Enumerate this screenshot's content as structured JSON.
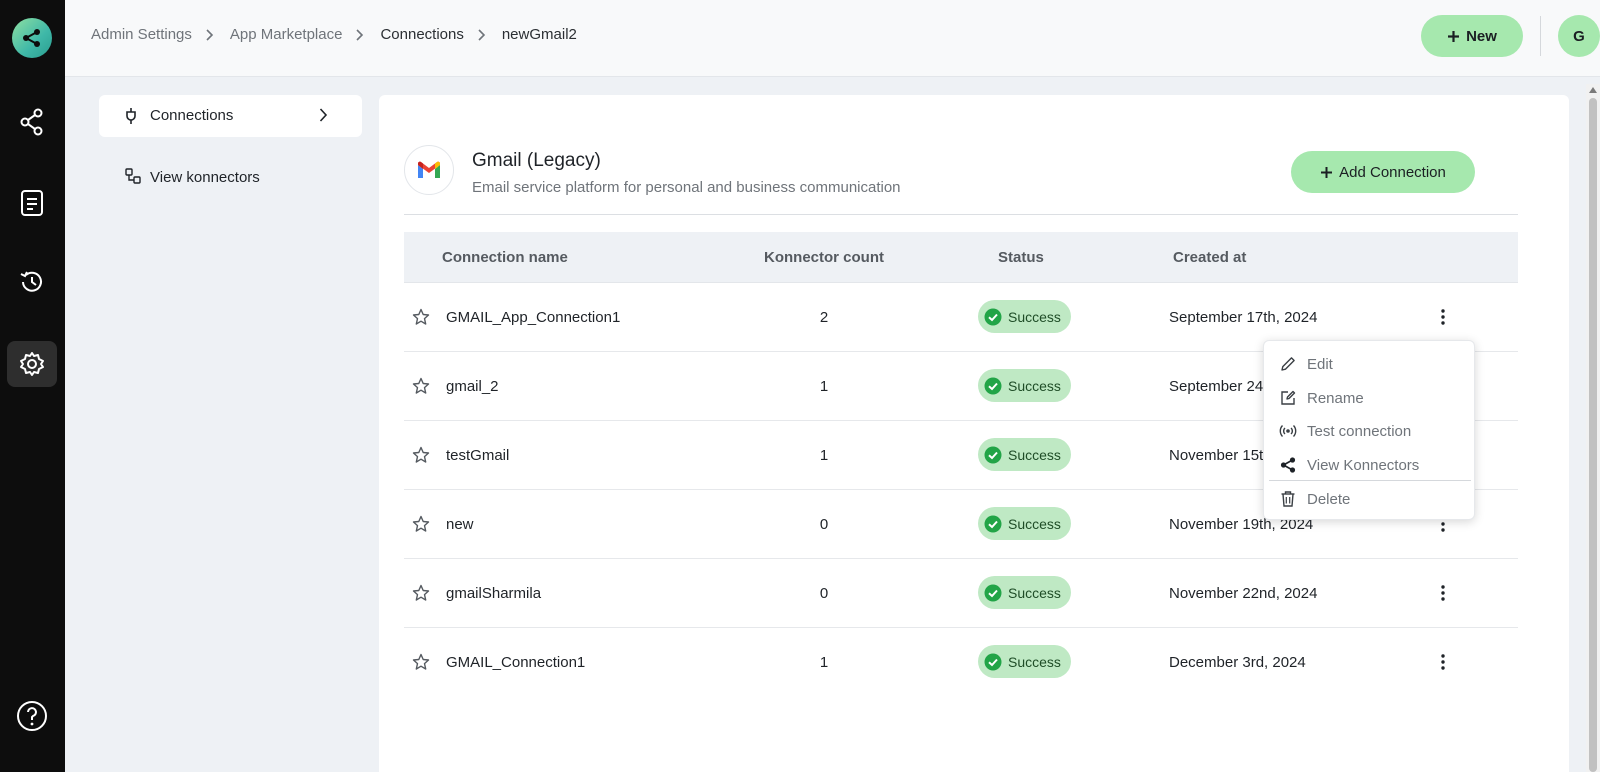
{
  "breadcrumb": [
    "Admin Settings",
    "App Marketplace",
    "Connections",
    "newGmail2"
  ],
  "header": {
    "new_label": "New",
    "avatar_initial": "G"
  },
  "subnav": {
    "connections_label": "Connections",
    "view_konnectors_label": "View konnectors"
  },
  "app": {
    "title": "Gmail (Legacy)",
    "description": "Email service platform for personal and business communication",
    "add_connection_label": "Add Connection"
  },
  "table": {
    "columns": [
      "Connection name",
      "Konnector count",
      "Status",
      "Created at"
    ],
    "rows": [
      {
        "name": "GMAIL_App_Connection1",
        "count": "2",
        "status": "Success",
        "created": "September 17th, 2024"
      },
      {
        "name": "gmail_2",
        "count": "1",
        "status": "Success",
        "created": "September 24"
      },
      {
        "name": "testGmail",
        "count": "1",
        "status": "Success",
        "created": "November 15t"
      },
      {
        "name": "new",
        "count": "0",
        "status": "Success",
        "created": "November 19th, 2024"
      },
      {
        "name": "gmailSharmila",
        "count": "0",
        "status": "Success",
        "created": "November 22nd, 2024"
      },
      {
        "name": "GMAIL_Connection1",
        "count": "1",
        "status": "Success",
        "created": "December 3rd, 2024"
      }
    ]
  },
  "menu": {
    "items": [
      {
        "label": "Edit",
        "icon": "pencil-icon"
      },
      {
        "label": "Rename",
        "icon": "rename-icon"
      },
      {
        "label": "Test connection",
        "icon": "broadcast-icon"
      },
      {
        "label": "View Konnectors",
        "icon": "share-icon"
      },
      {
        "label": "Delete",
        "icon": "trash-icon"
      }
    ]
  },
  "colors": {
    "accent": "#a6e8ae",
    "success_bg": "#bfe9c4",
    "success_icon": "#22a447",
    "rail": "#0d0d0d"
  }
}
